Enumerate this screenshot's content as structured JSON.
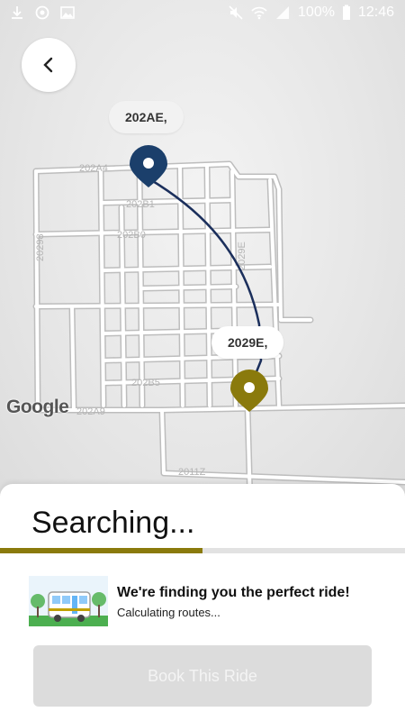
{
  "status_bar": {
    "battery_percent": "100%",
    "time": "12:46",
    "icons": [
      "download-icon",
      "sync-icon",
      "image-icon",
      "mute-icon",
      "wifi-icon",
      "signal-icon",
      "battery-icon"
    ]
  },
  "map": {
    "origin_label": "202AE,",
    "destination_label": "2029E,",
    "origin_color": "#1b3f6b",
    "destination_color": "#8a7a0c",
    "route_color": "#1b2f5c",
    "attribution": "Google",
    "street_labels": [
      "202A4",
      "202B1",
      "202B0",
      "202B5",
      "202A9",
      "2011Z",
      "20298",
      "2029E"
    ]
  },
  "sheet": {
    "title": "Searching...",
    "progress_fraction": 0.5,
    "progress_color": "#8a7a0c",
    "info_heading": "We're finding you the perfect ride!",
    "info_subtext": "Calculating routes...",
    "book_button_label": "Book This Ride",
    "book_button_enabled": false
  }
}
